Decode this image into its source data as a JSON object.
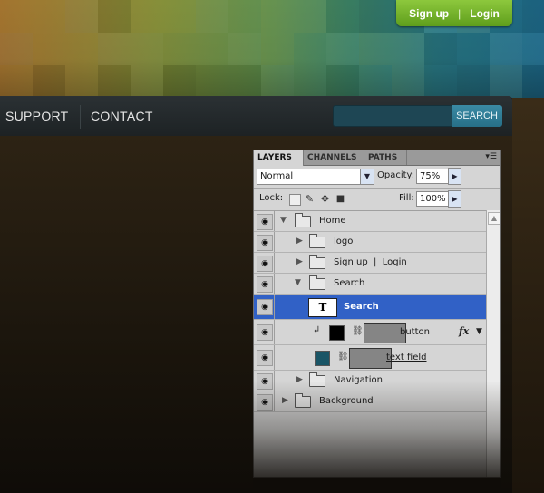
{
  "site": {
    "signup_label": "Sign up",
    "login_label": "Login",
    "auth_separator": "|",
    "nav": [
      "SUPPORT",
      "CONTACT"
    ],
    "search_button_label": "SEARCH",
    "colors": {
      "signup_green": "#6aaa27",
      "navbar": "#22282a",
      "search_blue": "#2f7e98",
      "search_field": "#1e4654"
    }
  },
  "layers_panel": {
    "tabs": [
      "LAYERS",
      "CHANNELS",
      "PATHS"
    ],
    "active_tab": "LAYERS",
    "blend_mode": "Normal",
    "opacity_label": "Opacity:",
    "opacity_value": "75%",
    "lock_label": "Lock:",
    "fill_label": "Fill:",
    "fill_value": "100%",
    "selection_color": "#3161c6",
    "layers": [
      {
        "name": "Home",
        "type": "group",
        "expanded": true
      },
      {
        "name": "logo",
        "type": "group",
        "expanded": false
      },
      {
        "name": "Sign up  |  Login",
        "type": "group",
        "expanded": false
      },
      {
        "name": "Search",
        "type": "group",
        "expanded": true
      },
      {
        "name": "Search",
        "type": "text",
        "selected": true
      },
      {
        "name": "button",
        "type": "shape",
        "clipped": true,
        "fx": "fx",
        "swatch": "#000000"
      },
      {
        "name": "text field",
        "type": "shape",
        "swatch": "#1a5566"
      },
      {
        "name": "Navigation",
        "type": "group",
        "expanded": false
      },
      {
        "name": "Background",
        "type": "group",
        "expanded": false
      }
    ]
  }
}
